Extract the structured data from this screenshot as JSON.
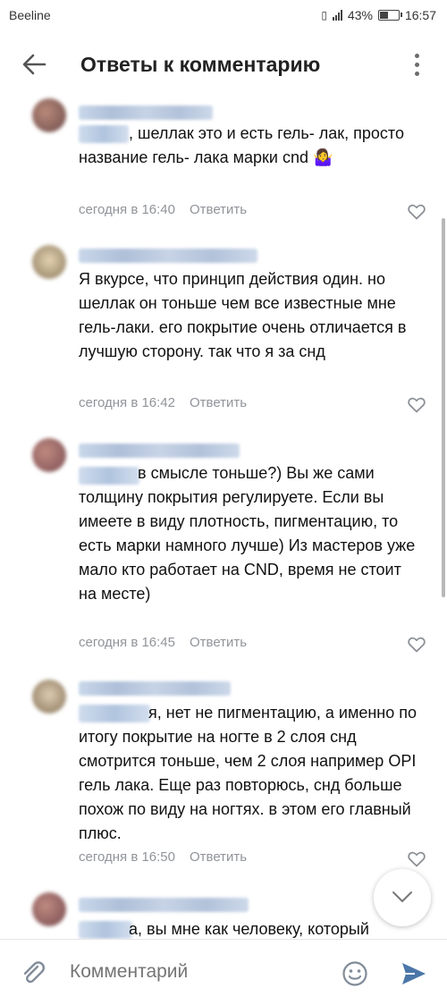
{
  "status_bar": {
    "carrier": "Beeline",
    "battery": "43%",
    "time": "16:57"
  },
  "header": {
    "title": "Ответы к комментарию"
  },
  "comments": [
    {
      "text": ", шеллак это и есть гель- лак, просто название гель- лака марки cnd 🤷‍♀️",
      "time": "сегодня в 16:40",
      "reply_label": "Ответить"
    },
    {
      "text": "Я вкурсе, что принцип действия один. но шеллак он тоньше чем все известные мне гель-лаки. его покрытие очень отличается в лучшую сторону. так что я за снд",
      "time": "сегодня в 16:42",
      "reply_label": "Ответить"
    },
    {
      "text": "в смысле тоньше?) Вы же сами толщину покрытия регулируете. Если вы имеете в виду плотность, пигментацию, то есть марки намного лучше) Из мастеров уже мало кто работает на CND, время не стоит на месте)",
      "time": "сегодня в 16:45",
      "reply_label": "Ответить"
    },
    {
      "text": "я, нет не пигментацию, а именно по итогу покрытие на ногте в 2 слоя снд смотрится тоньше, чем 2 слоя например OPI гель лака. Еще раз повторюсь, снд больше похож по виду на ногтях. в этом его главный плюс.",
      "time": "сегодня в 16:50",
      "reply_label": "Ответить"
    },
    {
      "text": "а, вы мне как человеку, который",
      "time": "",
      "reply_label": ""
    }
  ],
  "composer": {
    "placeholder": "Комментарий"
  },
  "icons": {
    "back": "arrow-left-icon",
    "menu": "more-vertical-icon",
    "like": "heart-outline-icon",
    "scroll_down": "chevron-down-icon",
    "attach": "paperclip-icon",
    "emoji": "smiley-icon",
    "send": "send-icon"
  },
  "colors": {
    "accent": "#4a76a8",
    "meta": "#909499",
    "blurred_name": "#b7c6dc"
  }
}
